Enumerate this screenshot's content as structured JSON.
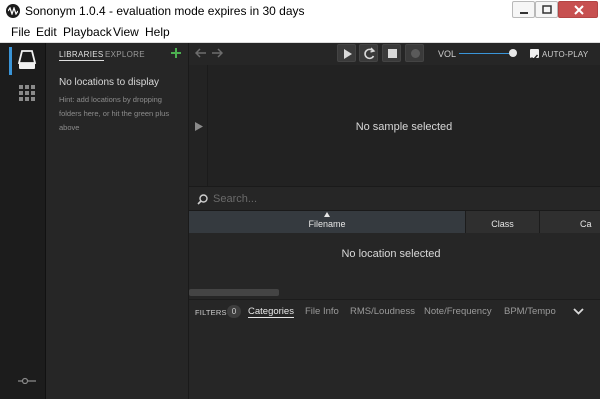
{
  "window": {
    "title": "Sononym 1.0.4 - evaluation mode expires in 30 days"
  },
  "menubar": {
    "items": [
      "File",
      "Edit",
      "Playback",
      "View",
      "Help"
    ]
  },
  "rail": {
    "icons": [
      "library-icon",
      "grid-icon",
      "settings-icon"
    ]
  },
  "libraries": {
    "tabs": [
      "LIBRARIES",
      "EXPLORE"
    ],
    "active_tab": "LIBRARIES",
    "empty_title": "No locations to display",
    "hint": "Hint: add locations by dropping folders here, or hit the green plus above"
  },
  "transport": {
    "vol_label": "VOL",
    "volume": 0.95,
    "autoplay_label": "AUTO-PLAY",
    "autoplay_checked": true
  },
  "sample": {
    "empty_text": "No sample selected"
  },
  "search": {
    "placeholder": "Search..."
  },
  "table": {
    "columns": [
      "Filename",
      "Class",
      "Ca"
    ],
    "sorted_column": "Filename",
    "empty_text": "No location selected"
  },
  "filters": {
    "label": "FILTERS",
    "count": "0",
    "tabs": [
      "Categories",
      "File Info",
      "RMS/Loudness",
      "Note/Frequency",
      "BPM/Tempo"
    ],
    "active_tab": "Categories"
  },
  "colors": {
    "accent": "#3a95d8",
    "add_green": "#4caf50",
    "background": "#262626"
  }
}
